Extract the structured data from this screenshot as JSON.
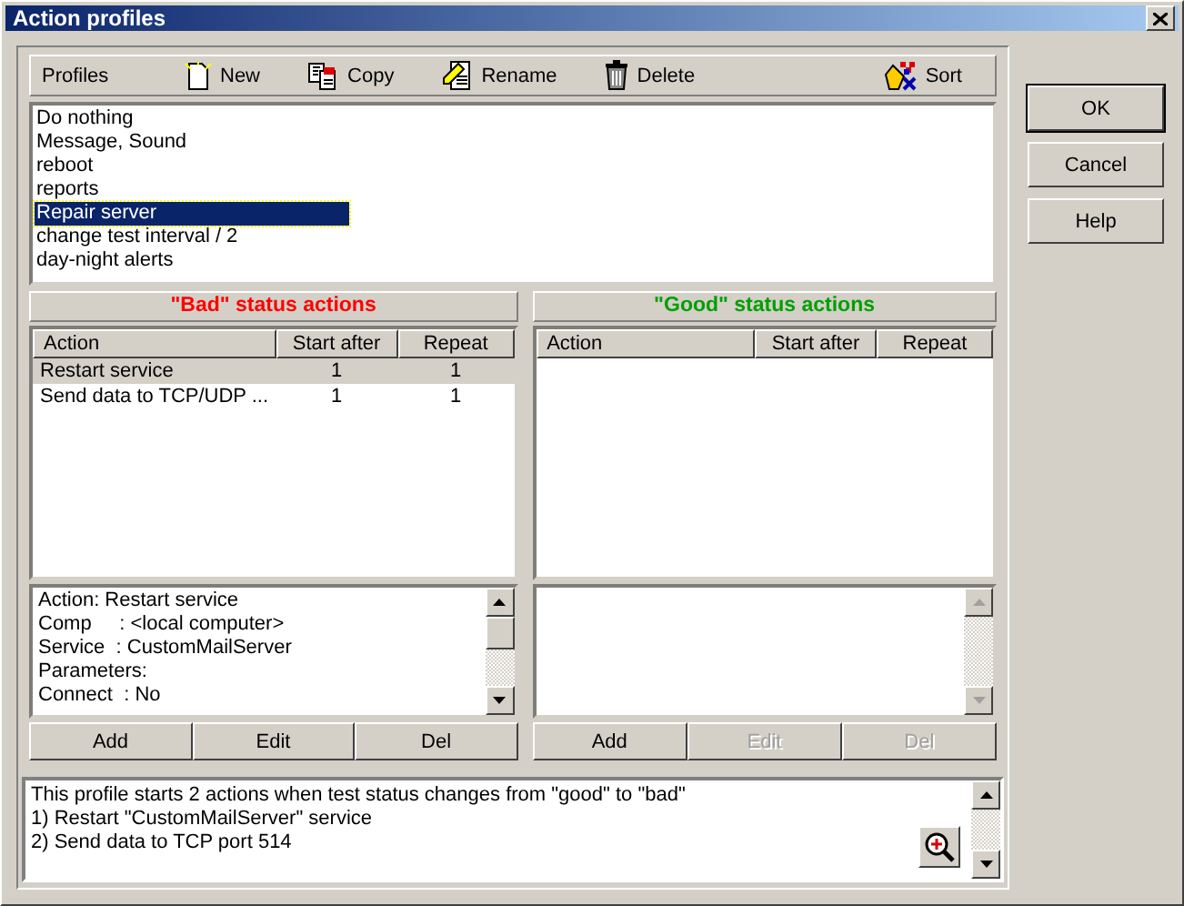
{
  "window": {
    "title": "Action profiles"
  },
  "toolbar": {
    "label": "Profiles",
    "buttons": [
      {
        "kind": "new",
        "label": "New"
      },
      {
        "kind": "copy",
        "label": "Copy"
      },
      {
        "kind": "rename",
        "label": "Rename"
      },
      {
        "kind": "delete",
        "label": "Delete"
      },
      {
        "kind": "sort",
        "label": "Sort"
      }
    ]
  },
  "profiles": [
    {
      "label": "Do nothing",
      "selected": false
    },
    {
      "label": "Message, Sound",
      "selected": false
    },
    {
      "label": "reboot",
      "selected": false
    },
    {
      "label": "reports",
      "selected": false
    },
    {
      "label": "Repair server",
      "selected": true
    },
    {
      "label": "change test interval / 2",
      "selected": false
    },
    {
      "label": "day-night alerts",
      "selected": false
    }
  ],
  "panes": [
    {
      "title": "\"Bad\" status actions",
      "color": "#ff0000",
      "columns": [
        "Action",
        "Start after",
        "Repeat"
      ],
      "rows": [
        {
          "cells": [
            "Restart service",
            "1",
            "1"
          ],
          "selected": true
        },
        {
          "cells": [
            "Send data to TCP/UDP ...",
            "1",
            "1"
          ],
          "selected": false
        }
      ],
      "details": [
        "Action: Restart service",
        "Comp     : <local computer>",
        "Service  : CustomMailServer",
        "Parameters:",
        "Connect  : No"
      ],
      "buttons": [
        {
          "label": "Add",
          "disabled": false
        },
        {
          "label": "Edit",
          "disabled": false
        },
        {
          "label": "Del",
          "disabled": false
        }
      ]
    },
    {
      "title": "\"Good\" status actions",
      "color": "#00a000",
      "columns": [
        "Action",
        "Start after",
        "Repeat"
      ],
      "buttons": [
        {
          "label": "Add",
          "disabled": false
        },
        {
          "label": "Edit",
          "disabled": true
        },
        {
          "label": "Del",
          "disabled": true
        }
      ]
    }
  ],
  "summary": [
    "This profile starts 2 actions when test status changes from \"good\" to \"bad\"",
    "1) Restart \"CustomMailServer\" service",
    "2) Send data to TCP port 514"
  ],
  "dialog_buttons": [
    {
      "label": "OK",
      "default": true
    },
    {
      "label": "Cancel",
      "default": false
    },
    {
      "label": "Help",
      "default": false
    }
  ]
}
